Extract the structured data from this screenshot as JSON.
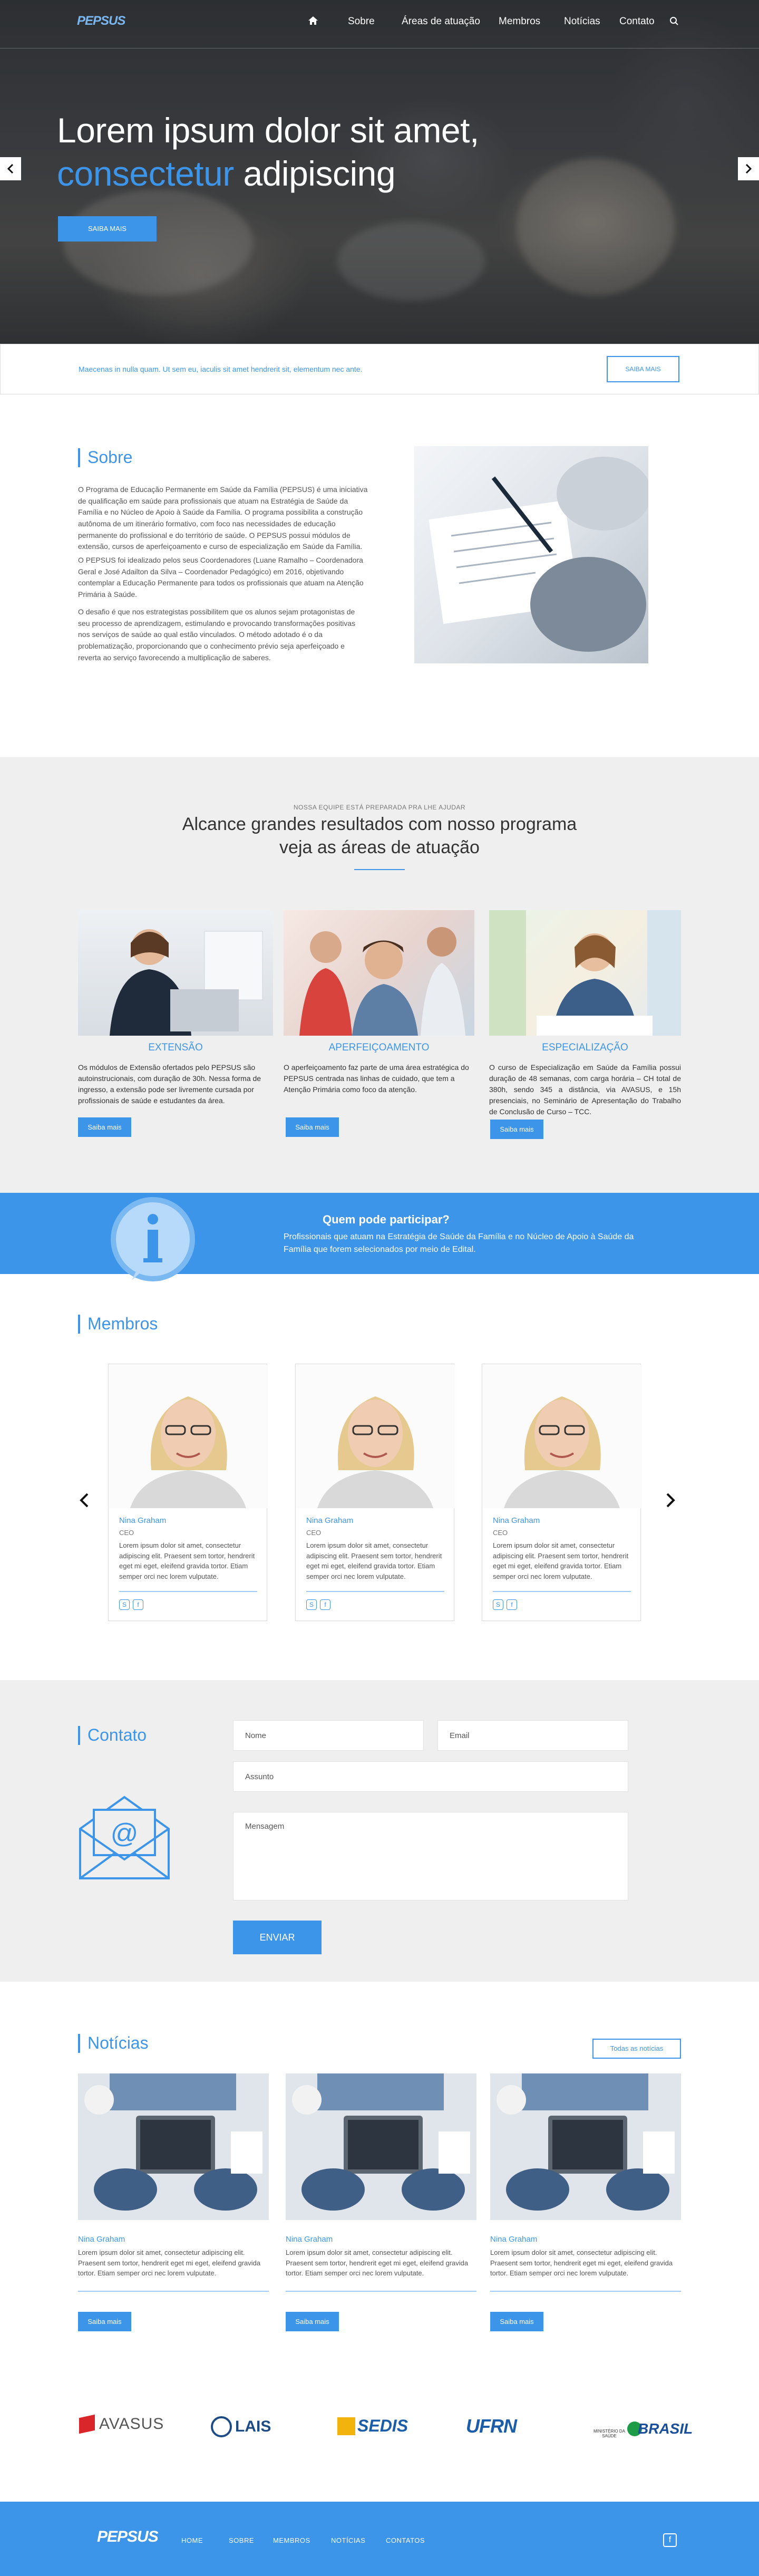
{
  "brand": {
    "logo_text": "PEPSUS"
  },
  "nav": {
    "items": [
      "Sobre",
      "Áreas de atuação",
      "Membros",
      "Notícias",
      "Contato"
    ]
  },
  "hero": {
    "line1": "Lorem ipsum dolor sit amet,",
    "line2_highlight": "consectetur",
    "line2_rest": " adipiscing",
    "button": "SAIBA MAIS"
  },
  "promo": {
    "text": "Maecenas in nulla quam. Ut sem eu, iaculis sit amet hendrerit sit, elementum nec ante.",
    "button": "SAIBA MAIS"
  },
  "sobre": {
    "title": "Sobre",
    "p1": "O Programa de Educação Permanente em Saúde da Família (PEPSUS) é uma iniciativa de qualificação em saúde para profissionais que atuam na Estratégia de Saúde da Família e no Núcleo de Apoio à Saúde da Família. O programa possibilita a construção autônoma de um itinerário formativo, com foco nas necessidades de educação permanente do profissional e do território de saúde. O PEPSUS possui módulos de extensão, cursos de aperfeiçoamento e curso de especialização em Saúde da Família.",
    "p2": "O PEPSUS foi idealizado pelos seus Coordenadores (Luane Ramalho – Coordenadora Geral e José Adailton da Silva – Coordenador Pedagógico) em 2016, objetivando contemplar a Educação Permanente para todos os profissionais que atuam na Atenção Primária à Saúde.",
    "p3": "O desafio é que nos estrategistas possibilitem que os alunos sejam protagonistas de seu processo de aprendizagem, estimulando e provocando transformações positivas nos serviços de saúde ao qual estão vinculados. O método adotado é o da problematização, proporcionando que o conhecimento prévio seja aperfeiçoado e reverta ao serviço favorecendo a multiplicação de saberes."
  },
  "areas": {
    "kicker": "NOSSA EQUIPE ESTÁ PREPARADA PRA LHE AJUDAR",
    "title_line1": "Alcance grandes resultados com nosso programa",
    "title_line2": "veja as áreas de atuação",
    "items": [
      {
        "title": "EXTENSÃO",
        "text": "Os módulos de Extensão ofertados pelo PEPSUS são autoinstrucionais, com duração de 30h. Nessa forma de ingresso, a extensão pode ser livremente cursada por profissionais de saúde e estudantes da área.",
        "button": "Saiba mais"
      },
      {
        "title": "APERFEIÇOAMENTO",
        "text": "O aperfeiçoamento faz parte de uma área estratégica do PEPSUS centrada nas linhas de cuidado, que tem a Atenção Primária como foco da atenção.",
        "button": "Saiba mais"
      },
      {
        "title": "ESPECIALIZAÇÃO",
        "text": "O curso de Especialização em Saúde da Família possui duração de 48 semanas, com carga horária – CH total de 380h, sendo 345 a distância, via AVASUS, e 15h presenciais, no Seminário de Apresentação do Trabalho de Conclusão de Curso – TCC.",
        "button": "Saiba mais"
      }
    ]
  },
  "info": {
    "title": "Quem pode participar?",
    "text": "Profissionais que atuam na Estratégia de Saúde da Família e no Núcleo de Apoio à Saúde da Família que forem selecionados por meio de Edital."
  },
  "membros": {
    "title": "Membros",
    "cards": [
      {
        "name": "Nina Graham",
        "role": "CEO",
        "text": "Lorem ipsum dolor sit amet, consectetur adipiscing elit. Praesent sem tortor, hendrerit eget mi eget, eleifend gravida tortor. Etiam semper orci nec lorem vulputate."
      },
      {
        "name": "Nina Graham",
        "role": "CEO",
        "text": "Lorem ipsum dolor sit amet, consectetur adipiscing elit. Praesent sem tortor, hendrerit eget mi eget, eleifend gravida tortor. Etiam semper orci nec lorem vulputate."
      },
      {
        "name": "Nina Graham",
        "role": "CEO",
        "text": "Lorem ipsum dolor sit amet, consectetur adipiscing elit. Praesent sem tortor, hendrerit eget mi eget, eleifend gravida tortor. Etiam semper orci nec lorem vulputate."
      }
    ]
  },
  "contato": {
    "title": "Contato",
    "name_placeholder": "Nome",
    "email_placeholder": "Email",
    "subject_placeholder": "Assunto",
    "message_placeholder": "Mensagem",
    "button": "ENVIAR"
  },
  "noticias": {
    "title": "Notícias",
    "all_button": "Todas as notícias",
    "items": [
      {
        "name": "Nina Graham",
        "text": "Lorem ipsum dolor sit amet, consectetur adipiscing elit. Praesent sem tortor, hendrerit eget mi eget, eleifend gravida tortor. Etiam semper orci nec lorem vulputate.",
        "button": "Saiba mais"
      },
      {
        "name": "Nina Graham",
        "text": "Lorem ipsum dolor sit amet, consectetur adipiscing elit. Praesent sem tortor, hendrerit eget mi eget, eleifend gravida tortor. Etiam semper orci nec lorem vulputate.",
        "button": "Saiba mais"
      },
      {
        "name": "Nina Graham",
        "text": "Lorem ipsum dolor sit amet, consectetur adipiscing elit. Praesent sem tortor, hendrerit eget mi eget, eleifend gravida tortor. Etiam semper orci nec lorem vulputate.",
        "button": "Saiba mais"
      }
    ]
  },
  "partners": [
    "AVASUS",
    "LAIS",
    "SEDIS",
    "UFRN",
    "MINISTÉRIO DA SAÚDE",
    "BRASIL"
  ],
  "footer": {
    "links": [
      "HOME",
      "SOBRE",
      "MEMBROS",
      "NOTÍCIAS",
      "CONTATOS"
    ]
  },
  "colors": {
    "primary": "#3d95ea",
    "light_bg": "#efefef"
  }
}
